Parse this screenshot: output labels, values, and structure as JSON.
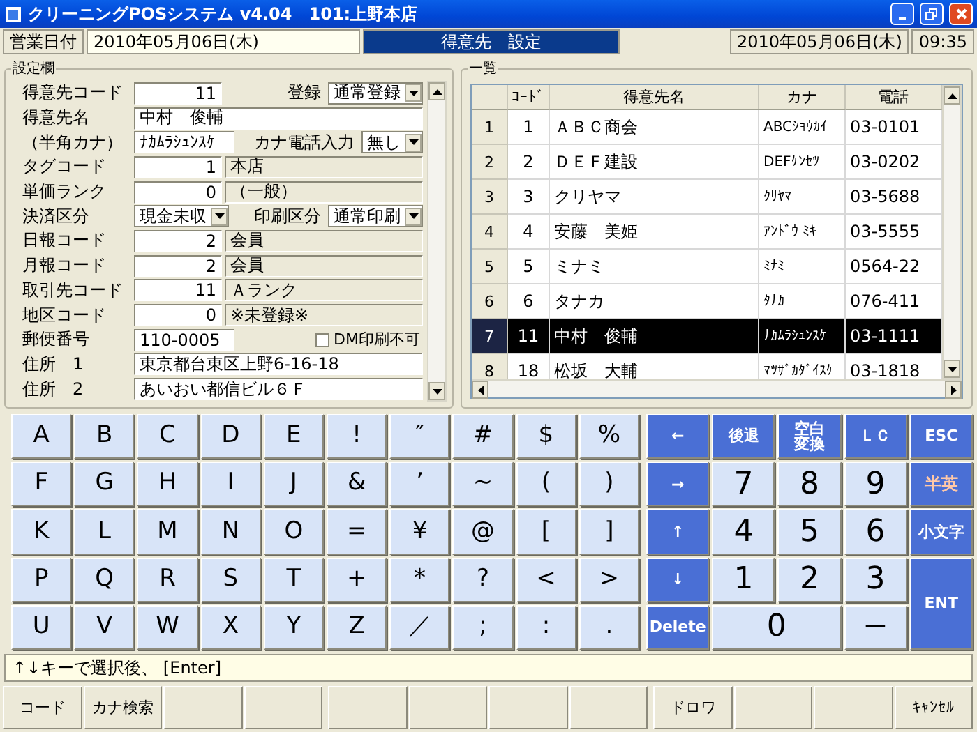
{
  "window": {
    "title": "クリーニングPOSシステム v4.04　101:上野本店"
  },
  "header": {
    "date_label": "営業日付",
    "business_date": "2010年05月06日(木)",
    "screen_title": "得意先　設定",
    "current_date": "2010年05月06日(木)",
    "time": "09:35"
  },
  "settings": {
    "title": "設定欄",
    "rows": [
      {
        "parts": [
          {
            "kind": "label",
            "text": "得意先コード"
          },
          {
            "kind": "number",
            "value": "11"
          },
          {
            "kind": "sublabel",
            "text": "登録"
          },
          {
            "kind": "select",
            "value": "通常登録"
          }
        ]
      },
      {
        "parts": [
          {
            "kind": "label",
            "text": "得意先名"
          },
          {
            "kind": "text",
            "value": "中村　俊輔"
          }
        ]
      },
      {
        "parts": [
          {
            "kind": "label",
            "text": "（半角カナ）"
          },
          {
            "kind": "short",
            "value": "ﾅｶﾑﾗｼｭﾝｽｹ"
          },
          {
            "kind": "sublabel",
            "text": "カナ電話入力"
          },
          {
            "kind": "select",
            "value": "無し"
          }
        ]
      },
      {
        "parts": [
          {
            "kind": "label",
            "text": "タグコード"
          },
          {
            "kind": "number",
            "value": "1"
          },
          {
            "kind": "readonly",
            "value": "本店"
          }
        ]
      },
      {
        "parts": [
          {
            "kind": "label",
            "text": "単価ランク"
          },
          {
            "kind": "number",
            "value": "0"
          },
          {
            "kind": "readonly",
            "value": "（一般）"
          }
        ]
      },
      {
        "parts": [
          {
            "kind": "label",
            "text": "決済区分"
          },
          {
            "kind": "select",
            "value": "現金未収"
          },
          {
            "kind": "sublabel",
            "text": "印刷区分"
          },
          {
            "kind": "select",
            "value": "通常印刷"
          }
        ]
      },
      {
        "parts": [
          {
            "kind": "label",
            "text": "日報コード"
          },
          {
            "kind": "number",
            "value": "2"
          },
          {
            "kind": "readonly",
            "value": "会員"
          }
        ]
      },
      {
        "parts": [
          {
            "kind": "label",
            "text": "月報コード"
          },
          {
            "kind": "number",
            "value": "2"
          },
          {
            "kind": "readonly",
            "value": "会員"
          }
        ]
      },
      {
        "parts": [
          {
            "kind": "label",
            "text": "取引先コード"
          },
          {
            "kind": "number",
            "value": "11"
          },
          {
            "kind": "readonly",
            "value": "Ａランク"
          }
        ]
      },
      {
        "parts": [
          {
            "kind": "label",
            "text": "地区コード"
          },
          {
            "kind": "number",
            "value": "0"
          },
          {
            "kind": "readonly",
            "value": "※未登録※"
          }
        ]
      },
      {
        "parts": [
          {
            "kind": "label",
            "text": "郵便番号"
          },
          {
            "kind": "short",
            "value": "110-0005"
          },
          {
            "kind": "checkbox",
            "text": "DM印刷不可",
            "checked": false
          }
        ]
      },
      {
        "parts": [
          {
            "kind": "label",
            "text": "住所　1"
          },
          {
            "kind": "text",
            "value": "東京都台東区上野6-16-18"
          }
        ]
      },
      {
        "parts": [
          {
            "kind": "label",
            "text": "住所　2"
          },
          {
            "kind": "text",
            "value": "あいおい都信ビル６Ｆ"
          }
        ]
      }
    ]
  },
  "list": {
    "title": "一覧",
    "columns": [
      "ｺｰﾄﾞ",
      "得意先名",
      "カナ",
      "電話"
    ],
    "rows": [
      {
        "number": "1",
        "cells": [
          "1",
          "ＡＢＣ商会",
          "ABCｼｮｳｶｲ",
          "03-0101"
        ],
        "selected": false
      },
      {
        "number": "2",
        "cells": [
          "2",
          "ＤＥＦ建設",
          "DEFｹﾝｾﾂ",
          "03-0202"
        ],
        "selected": false
      },
      {
        "number": "3",
        "cells": [
          "3",
          "クリヤマ",
          "ｸﾘﾔﾏ",
          "03-5688"
        ],
        "selected": false
      },
      {
        "number": "4",
        "cells": [
          "4",
          "安藤　美姫",
          "ｱﾝﾄﾞｳ ﾐｷ",
          "03-5555"
        ],
        "selected": false
      },
      {
        "number": "5",
        "cells": [
          "5",
          "ミナミ",
          "ﾐﾅﾐ",
          "0564-22"
        ],
        "selected": false
      },
      {
        "number": "6",
        "cells": [
          "6",
          "タナカ",
          "ﾀﾅｶ",
          "076-411"
        ],
        "selected": false
      },
      {
        "number": "7",
        "cells": [
          "11",
          "中村　俊輔",
          "ﾅｶﾑﾗｼｭﾝｽｹ",
          "03-1111"
        ],
        "selected": true
      },
      {
        "number": "8",
        "cells": [
          "18",
          "松坂　大輔",
          "ﾏﾂｻﾞｶﾀﾞｲｽｹ",
          "03-1818"
        ],
        "selected": false
      }
    ]
  },
  "keyboard": {
    "letter_keys": [
      "A",
      "B",
      "C",
      "D",
      "E",
      "!",
      "″",
      "#",
      "$",
      "%",
      "F",
      "G",
      "H",
      "I",
      "J",
      "&",
      "’",
      "~",
      "(",
      ")",
      "K",
      "L",
      "M",
      "N",
      "O",
      "=",
      "¥",
      "@",
      "[",
      "]",
      "P",
      "Q",
      "R",
      "S",
      "T",
      "+",
      "*",
      "?",
      "<",
      ">",
      "U",
      "V",
      "W",
      "X",
      "Y",
      "Z",
      "／",
      ";",
      ":",
      "."
    ],
    "control_keys": [
      {
        "label": "←",
        "kind": "func"
      },
      {
        "label": "後退",
        "kind": "func"
      },
      {
        "label": "空白変換",
        "kind": "func"
      },
      {
        "label": "ＬＣ",
        "kind": "func"
      },
      {
        "label": "ESC",
        "kind": "func"
      },
      {
        "label": "→",
        "kind": "func"
      },
      {
        "label": "7",
        "kind": "num"
      },
      {
        "label": "8",
        "kind": "num"
      },
      {
        "label": "9",
        "kind": "num"
      },
      {
        "label": "半英",
        "kind": "toggle"
      },
      {
        "label": "↑",
        "kind": "func"
      },
      {
        "label": "4",
        "kind": "num"
      },
      {
        "label": "5",
        "kind": "num"
      },
      {
        "label": "6",
        "kind": "num"
      },
      {
        "label": "小文字",
        "kind": "func"
      },
      {
        "label": "↓",
        "kind": "func"
      },
      {
        "label": "1",
        "kind": "num"
      },
      {
        "label": "2",
        "kind": "num"
      },
      {
        "label": "3",
        "kind": "num"
      },
      {
        "label": "ENT",
        "kind": "enter"
      },
      {
        "label": "Delete",
        "kind": "func"
      },
      {
        "label": "0",
        "kind": "zero"
      },
      {
        "label": "−",
        "kind": "num"
      }
    ]
  },
  "status_bar": {
    "message": "↑↓キーで選択後、 [Enter]"
  },
  "function_keys": [
    {
      "kind": "labeled",
      "label": "コード"
    },
    {
      "kind": "labeled",
      "label": "カナ検索"
    },
    {
      "kind": "blank"
    },
    {
      "kind": "blank"
    },
    {
      "kind": "blank"
    },
    {
      "kind": "blank"
    },
    {
      "kind": "blank"
    },
    {
      "kind": "blank"
    },
    {
      "kind": "labeled",
      "label": "ドロワ"
    },
    {
      "kind": "blank"
    },
    {
      "kind": "blank"
    },
    {
      "kind": "labeled",
      "label": "ｷｬﾝｾﾙ"
    }
  ]
}
